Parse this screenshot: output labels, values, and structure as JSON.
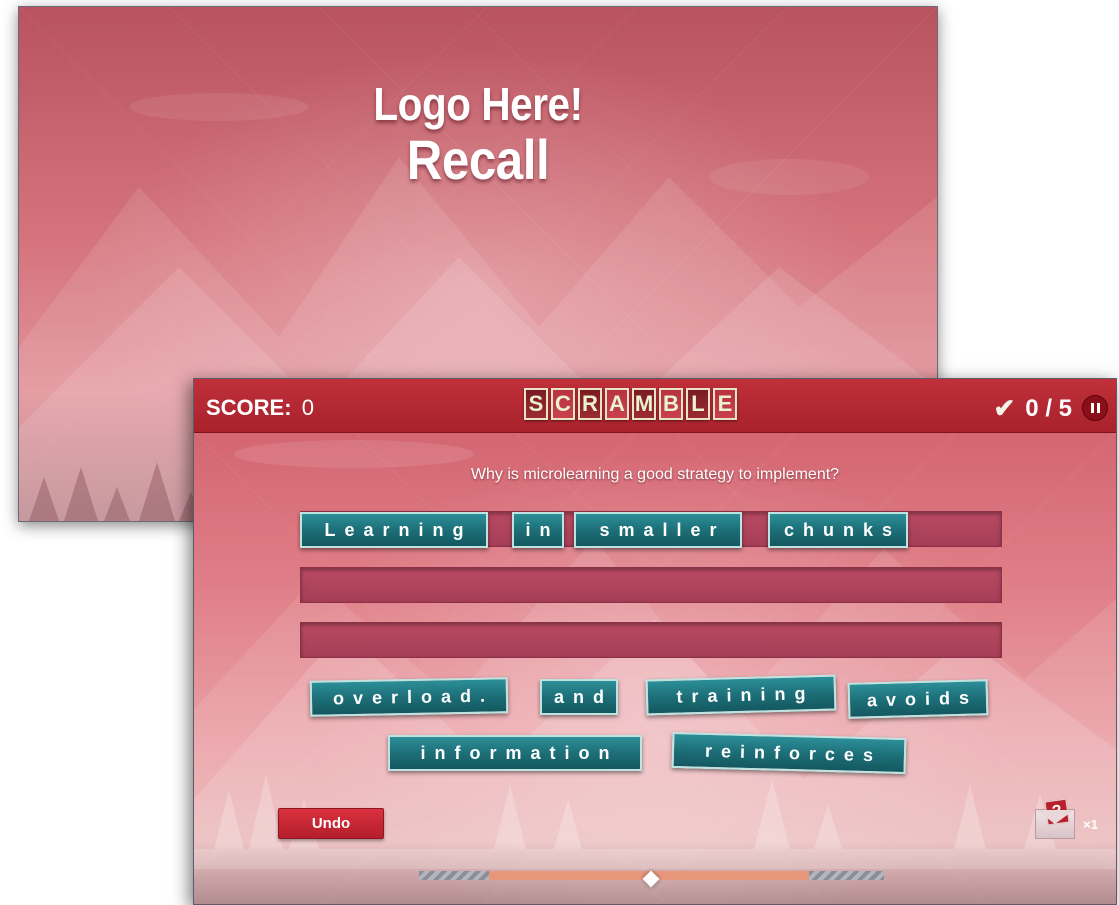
{
  "background_screen": {
    "logo_text": "Logo Here!",
    "title": "Recall"
  },
  "game": {
    "score_label": "SCORE:",
    "score_value": "0",
    "title_letters": [
      "S",
      "C",
      "R",
      "A",
      "M",
      "B",
      "L",
      "E"
    ],
    "progress_text": "0 / 5",
    "question": "Why is microlearning a good strategy to implement?",
    "answer_rows": [
      {
        "words": [
          "Learning",
          "in",
          "smaller",
          "chunks"
        ]
      },
      {
        "words": []
      },
      {
        "words": []
      }
    ],
    "word_bank": [
      "overload.",
      "and",
      "training",
      "avoids",
      "information",
      "reinforces"
    ],
    "undo_label": "Undo",
    "hint_count": "×1",
    "level_progress": 0.5
  },
  "colors": {
    "topbar": "#b02630",
    "tile": "#1d6f78",
    "accent_red": "#c8303d",
    "progress_fill": "#e9906e"
  },
  "icons": [
    "check-icon",
    "pause-icon",
    "envelope-hint-icon"
  ]
}
